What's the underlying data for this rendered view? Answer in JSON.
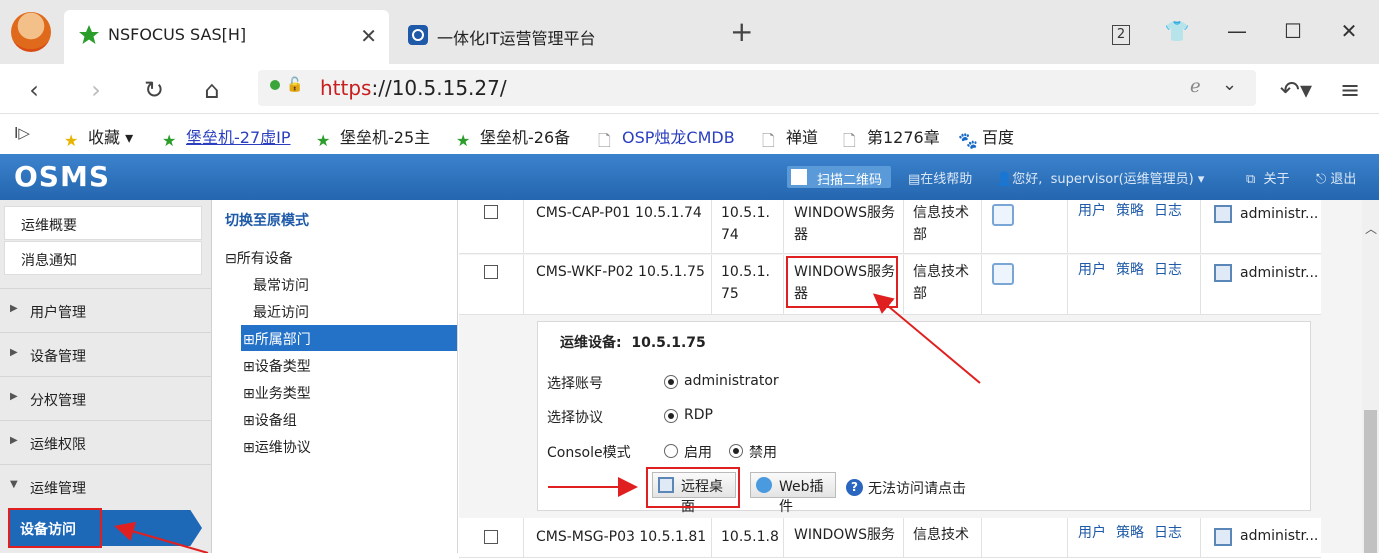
{
  "browser": {
    "tabs": [
      {
        "title": "NSFOCUS SAS[H]",
        "active": true
      },
      {
        "title": "一体化IT运营管理平台",
        "active": false
      }
    ],
    "url_scheme": "https",
    "url_rest": "://10.5.15.27/",
    "tab_counter": "2",
    "bookmarks": [
      {
        "label": "收藏",
        "icon": "star-icon"
      },
      {
        "label": "堡垒机-27虚IP",
        "icon": "star-icon"
      },
      {
        "label": "堡垒机-25主",
        "icon": "star-icon"
      },
      {
        "label": "堡垒机-26备",
        "icon": "star-icon"
      },
      {
        "label": "OSP烛龙CMDB",
        "icon": "page-icon"
      },
      {
        "label": "禅道",
        "icon": "page-icon"
      },
      {
        "label": "第1276章",
        "icon": "page-icon"
      },
      {
        "label": "百度",
        "icon": "paw-icon"
      }
    ]
  },
  "app": {
    "logo": "OSMS",
    "header": {
      "qr": "扫描二维码",
      "help": "在线帮助",
      "greeting": "您好,",
      "user": "supervisor(运维管理员)",
      "about": "关于",
      "logout": "退出"
    },
    "menu": {
      "top_items": [
        "运维概要",
        "消息通知"
      ],
      "groups": [
        "用户管理",
        "设备管理",
        "分权管理",
        "运维权限",
        "运维管理"
      ],
      "selected": "设备访问"
    },
    "tree": {
      "switch": "切换至原模式",
      "root": "所有设备",
      "children": [
        "最常访问",
        "最近访问"
      ],
      "nodes": [
        "所属部门",
        "设备类型",
        "业务类型",
        "设备组",
        "运维协议"
      ]
    },
    "rows": [
      {
        "name": "CMS-CAP-P01 10.5.1.74",
        "ip": "10.5.1.74",
        "type": "WINDOWS服务器",
        "dept": "信息技术部",
        "ops": [
          "用户",
          "策略",
          "日志"
        ],
        "account": "administr..."
      },
      {
        "name": "CMS-WKF-P02 10.5.1.75",
        "ip": "10.5.1.75",
        "type": "WINDOWS服务器",
        "dept": "信息技术部",
        "ops": [
          "用户",
          "策略",
          "日志"
        ],
        "account": "administr..."
      },
      {
        "name": "CMS-MSG-P03 10.5.1.81",
        "ip": "10.5.1.8",
        "type": "WINDOWS服务",
        "dept": "信息技术",
        "ops": [
          "用户",
          "策略",
          "日志"
        ],
        "account": "administr..."
      }
    ],
    "detail": {
      "device_label": "运维设备:",
      "device_ip": "10.5.1.75",
      "account_label": "选择账号",
      "account_value": "administrator",
      "protocol_label": "选择协议",
      "protocol_value": "RDP",
      "console_label": "Console模式",
      "console_on": "启用",
      "console_off": "禁用",
      "remote_btn": "远程桌面",
      "web_btn": "Web插件",
      "help_link": "无法访问请点击"
    },
    "annotation_color": "#e02020"
  }
}
